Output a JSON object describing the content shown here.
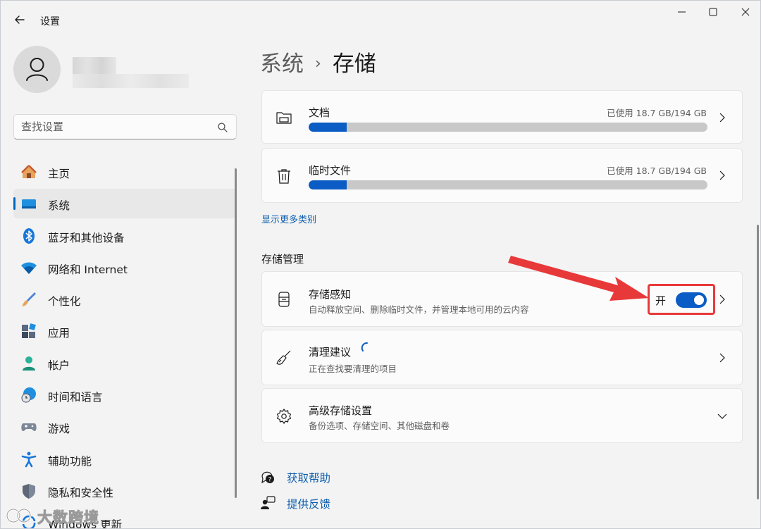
{
  "window": {
    "app_title": "设置"
  },
  "search": {
    "placeholder": "查找设置"
  },
  "sidebar": {
    "items": [
      {
        "label": "主页",
        "icon": "home-icon"
      },
      {
        "label": "系统",
        "icon": "system-icon",
        "active": true
      },
      {
        "label": "蓝牙和其他设备",
        "icon": "bluetooth-icon"
      },
      {
        "label": "网络和 Internet",
        "icon": "wifi-icon"
      },
      {
        "label": "个性化",
        "icon": "brush-icon"
      },
      {
        "label": "应用",
        "icon": "apps-icon"
      },
      {
        "label": "帐户",
        "icon": "account-icon"
      },
      {
        "label": "时间和语言",
        "icon": "globe-clock-icon"
      },
      {
        "label": "游戏",
        "icon": "gamepad-icon"
      },
      {
        "label": "辅助功能",
        "icon": "accessibility-icon"
      },
      {
        "label": "隐私和安全性",
        "icon": "shield-icon"
      },
      {
        "label": "Windows 更新",
        "icon": "update-icon"
      }
    ]
  },
  "breadcrumb": {
    "parent": "系统",
    "separator": "›",
    "current": "存储"
  },
  "storage_items": [
    {
      "title": "文档",
      "usage": "已使用 18.7 GB/194 GB",
      "fill_fraction": 0.096,
      "icon": "folder-icon"
    },
    {
      "title": "临时文件",
      "usage": "已使用 18.7 GB/194 GB",
      "fill_fraction": 0.096,
      "icon": "trash-icon"
    }
  ],
  "show_more": "显示更多类别",
  "management": {
    "section_title": "存储管理",
    "storage_sense": {
      "title": "存储感知",
      "subtitle": "自动释放空间、删除临时文件，并管理本地可用的云内容",
      "toggle_label": "开",
      "toggle_on": true,
      "icon": "storage-drive-icon"
    },
    "cleanup": {
      "title": "清理建议",
      "subtitle": "正在查找要清理的项目",
      "icon": "broom-icon"
    },
    "advanced": {
      "title": "高级存储设置",
      "subtitle": "备份选项、存储空间、其他磁盘和卷",
      "icon": "gear-icon"
    }
  },
  "help": {
    "get_help": "获取帮助",
    "feedback": "提供反馈"
  },
  "colors": {
    "accent": "#0b5cc4",
    "highlight_box": "#e8393a",
    "link": "#0b5cad"
  },
  "watermark": {
    "text": "大数跨境"
  }
}
